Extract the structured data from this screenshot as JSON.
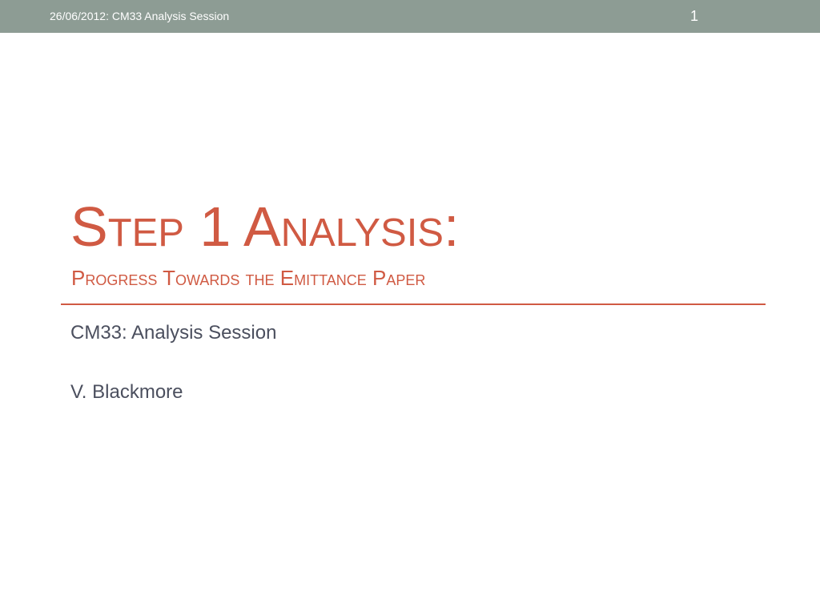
{
  "header": {
    "text": "26/06/2012: CM33 Analysis Session",
    "slide_number": "1"
  },
  "title": {
    "main": "Step 1 Analysis:",
    "subtitle": "Progress Towards the Emittance Paper"
  },
  "body": {
    "event": "CM33: Analysis Session",
    "author": "V. Blackmore"
  },
  "colors": {
    "header_bar": "#8d9c94",
    "accent": "#d05a43",
    "body_text": "#4b4f5e"
  }
}
